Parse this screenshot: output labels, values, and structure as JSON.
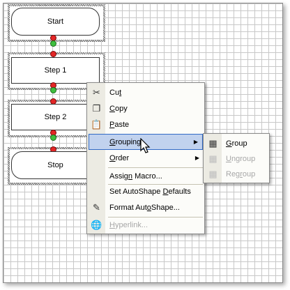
{
  "flowchart": {
    "shapes": [
      {
        "label": "Start"
      },
      {
        "label": "Step 1"
      },
      {
        "label": "Step 2"
      },
      {
        "label": "Stop"
      }
    ]
  },
  "context_menu": {
    "items": [
      {
        "label": "Cut",
        "accel": "t",
        "icon": "scissors-icon",
        "enabled": true
      },
      {
        "label": "Copy",
        "accel": "C",
        "icon": "copy-icon",
        "enabled": true
      },
      {
        "label": "Paste",
        "accel": "P",
        "icon": "paste-icon",
        "enabled": true
      },
      {
        "label": "Grouping",
        "accel": "G",
        "submenu": true,
        "highlighted": true
      },
      {
        "label": "Order",
        "accel": "O",
        "submenu": true
      },
      {
        "label": "Assign Macro...",
        "accel": "n"
      },
      {
        "label": "Set AutoShape Defaults",
        "accel": "D"
      },
      {
        "label": "Format AutoShape...",
        "accel": "o",
        "icon": "format-shape-icon"
      },
      {
        "label": "Hyperlink...",
        "accel": "H",
        "icon": "hyperlink-icon",
        "enabled": false
      }
    ]
  },
  "submenu": {
    "items": [
      {
        "label": "Group",
        "accel": "G",
        "icon": "group-icon",
        "enabled": true
      },
      {
        "label": "Ungroup",
        "accel": "U",
        "icon": "ungroup-icon",
        "enabled": false
      },
      {
        "label": "Regroup",
        "accel": "o",
        "icon": "regroup-icon",
        "enabled": false
      }
    ]
  },
  "colors": {
    "highlight": "#c1d2ee",
    "highlight_border": "#316ac5",
    "connector_red": "#e32626",
    "connector_green": "#3fbf3f"
  }
}
